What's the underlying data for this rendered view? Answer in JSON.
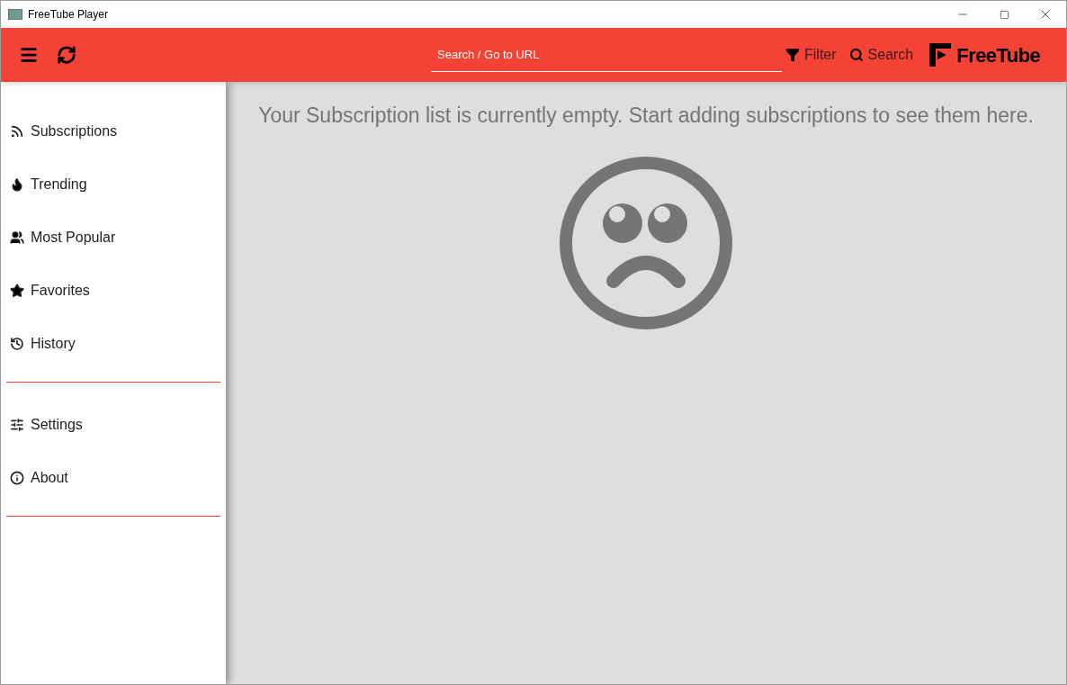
{
  "window": {
    "title": "FreeTube Player"
  },
  "topbar": {
    "search": {
      "placeholder": "Search / Go to URL"
    },
    "filter_label": "Filter",
    "search_label": "Search",
    "logo_text": "FreeTube"
  },
  "sidebar": {
    "sections": [
      {
        "items": [
          {
            "label": "Subscriptions"
          },
          {
            "label": "Trending"
          },
          {
            "label": "Most Popular"
          },
          {
            "label": "Favorites"
          },
          {
            "label": "History"
          }
        ]
      },
      {
        "items": [
          {
            "label": "Settings"
          },
          {
            "label": "About"
          }
        ]
      }
    ]
  },
  "main": {
    "message": "Your Subscription list is currently empty. Start adding subscriptions to see them here."
  }
}
